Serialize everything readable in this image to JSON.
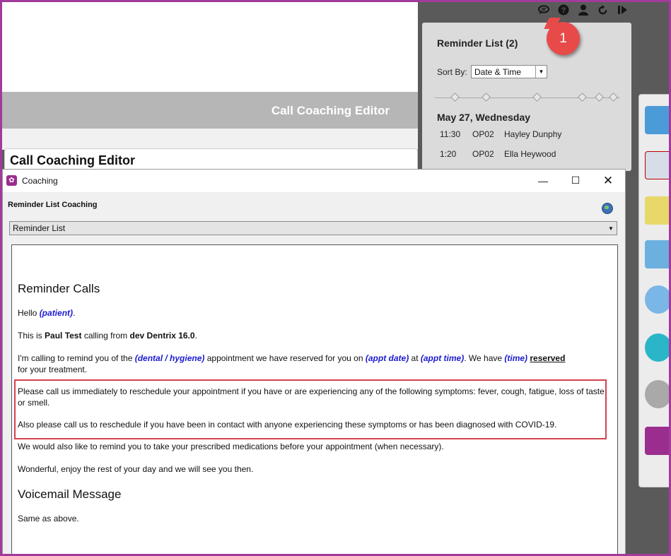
{
  "background_app": {
    "banner_title": "Call Coaching Editor",
    "section_title": "Call Coaching Editor"
  },
  "reminder_list": {
    "title": "Reminder List (2)",
    "sort_label": "Sort By:",
    "sort_value": "Date & Time",
    "date_heading": "May 27, Wednesday",
    "appointments": [
      {
        "time": "11:30",
        "op": "OP02",
        "name": "Hayley Dunphy"
      },
      {
        "time": "1:20",
        "op": "OP02",
        "name": "Ella Heywood"
      }
    ]
  },
  "callout": {
    "number": "1"
  },
  "dialog": {
    "title": "Coaching",
    "subheader": "Reminder List Coaching",
    "topic": "Reminder List",
    "content": {
      "heading1": "Reminder Calls",
      "hello_prefix": "Hello ",
      "patient_var": "(patient)",
      "hello_suffix": ".",
      "intro_a": "This is ",
      "caller_name": "Paul Test",
      "intro_b": " calling from ",
      "practice": "dev Dentrix 16.0",
      "intro_c": ".",
      "remind_a": "I'm calling to remind you of the ",
      "appt_type_var": "(dental / hygiene)",
      "remind_b": " appointment we have reserved for you on ",
      "appt_date_var": "(appt date)",
      "remind_c": " at ",
      "appt_time_var": "(appt time)",
      "remind_d": ". We have ",
      "time_var": "(time)",
      "remind_e": " ",
      "reserved_word": "reserved",
      "remind_f": "for your treatment.",
      "covid_1": "Please call us immediately to reschedule your appointment if you have or are experiencing any of the following symptoms: fever, cough, fatigue, loss of taste or smell.",
      "covid_2": "Also please call us to reschedule if you have been in contact with anyone experiencing these symptoms or has been diagnosed with COVID-19.",
      "meds": "We would also like to remind you to take your prescribed medications before your appointment (when necessary).",
      "closing": "Wonderful, enjoy the rest of your day and we will see you then.",
      "heading2": "Voicemail Message",
      "voicemail": "Same as above."
    }
  },
  "colors": {
    "frame": "#a23a9c",
    "highlight_box": "#d4414f",
    "variable_text": "#1b1bd0",
    "badge": "#e84a4a"
  },
  "icons": [
    "chat-icon",
    "help-icon",
    "user-icon",
    "refresh-icon",
    "play-end-icon",
    "globe-icon",
    "close-icon",
    "maximize-icon",
    "minimize-icon",
    "chevron-down-icon"
  ]
}
